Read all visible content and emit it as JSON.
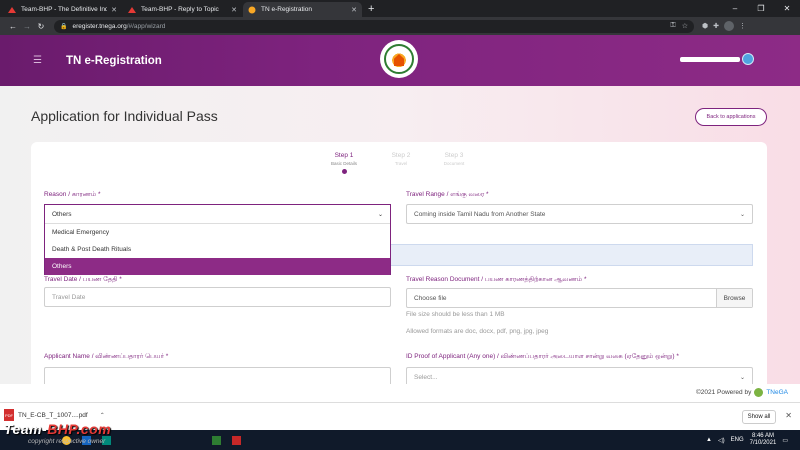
{
  "browser": {
    "tabs": [
      {
        "title": "Team-BHP - The Definitive Indian",
        "active": false
      },
      {
        "title": "Team-BHP - Reply to Topic",
        "active": false
      },
      {
        "title": "TN e-Registration",
        "active": true
      }
    ],
    "new_tab_icon": "plus-icon",
    "url_host": "eregister.tnega.org",
    "url_path": "/#/app/wizard"
  },
  "header": {
    "brand": "TN e-Registration",
    "menu_icon": "hamburger-icon"
  },
  "page": {
    "title": "Application for Individual Pass",
    "back_button": "Back to applications"
  },
  "wizard": {
    "steps": [
      {
        "name": "Step 1",
        "sub": "Basic Details",
        "active": true
      },
      {
        "name": "Step 2",
        "sub": "Travel",
        "active": false
      },
      {
        "name": "Step 3",
        "sub": "Document",
        "active": false
      }
    ]
  },
  "form": {
    "reason": {
      "label": "Reason / காரணம் *",
      "value": "Others",
      "options": [
        "Medical Emergency",
        "Death & Post Death Rituals",
        "Others"
      ],
      "highlighted": "Others"
    },
    "travel_range": {
      "label": "Travel Range / எங்கு வரை *",
      "value": "Coming inside Tamil Nadu from Another State"
    },
    "travel_date": {
      "label": "Travel Date / பயண தேதி *",
      "placeholder": "Travel Date"
    },
    "travel_reason_doc": {
      "label": "Travel Reason Document / பயண காரணத்திற்கான ஆவணம் *",
      "placeholder": "Choose file",
      "browse": "Browse",
      "hint_size": "File size should be less than 1 MB",
      "hint_formats": "Allowed formats are doc, docx, pdf, png, jpg, jpeg"
    },
    "applicant_name": {
      "label": "Applicant Name / விண்ணப்பதாரர் பெயர் *"
    },
    "id_proof": {
      "label": "ID Proof of Applicant (Any one) / விண்ணப்பதாரர் அடையாள சான்று வகை (ஏதேனும் ஒன்று) *",
      "placeholder": "Select..."
    }
  },
  "footer": {
    "copyright": "©2021 Powered by",
    "link": "TNeGA"
  },
  "downloads": {
    "file": "TN_E-CB_T_1007....pdf",
    "show_all": "Show all"
  },
  "watermark": {
    "brand_white": "Team-",
    "brand_red": "BHP",
    "brand_suffix": ".com",
    "sub": "copyright respective owner"
  },
  "taskbar": {
    "lang": "ENG",
    "time": "8:46 AM",
    "date": "7/10/2021"
  }
}
